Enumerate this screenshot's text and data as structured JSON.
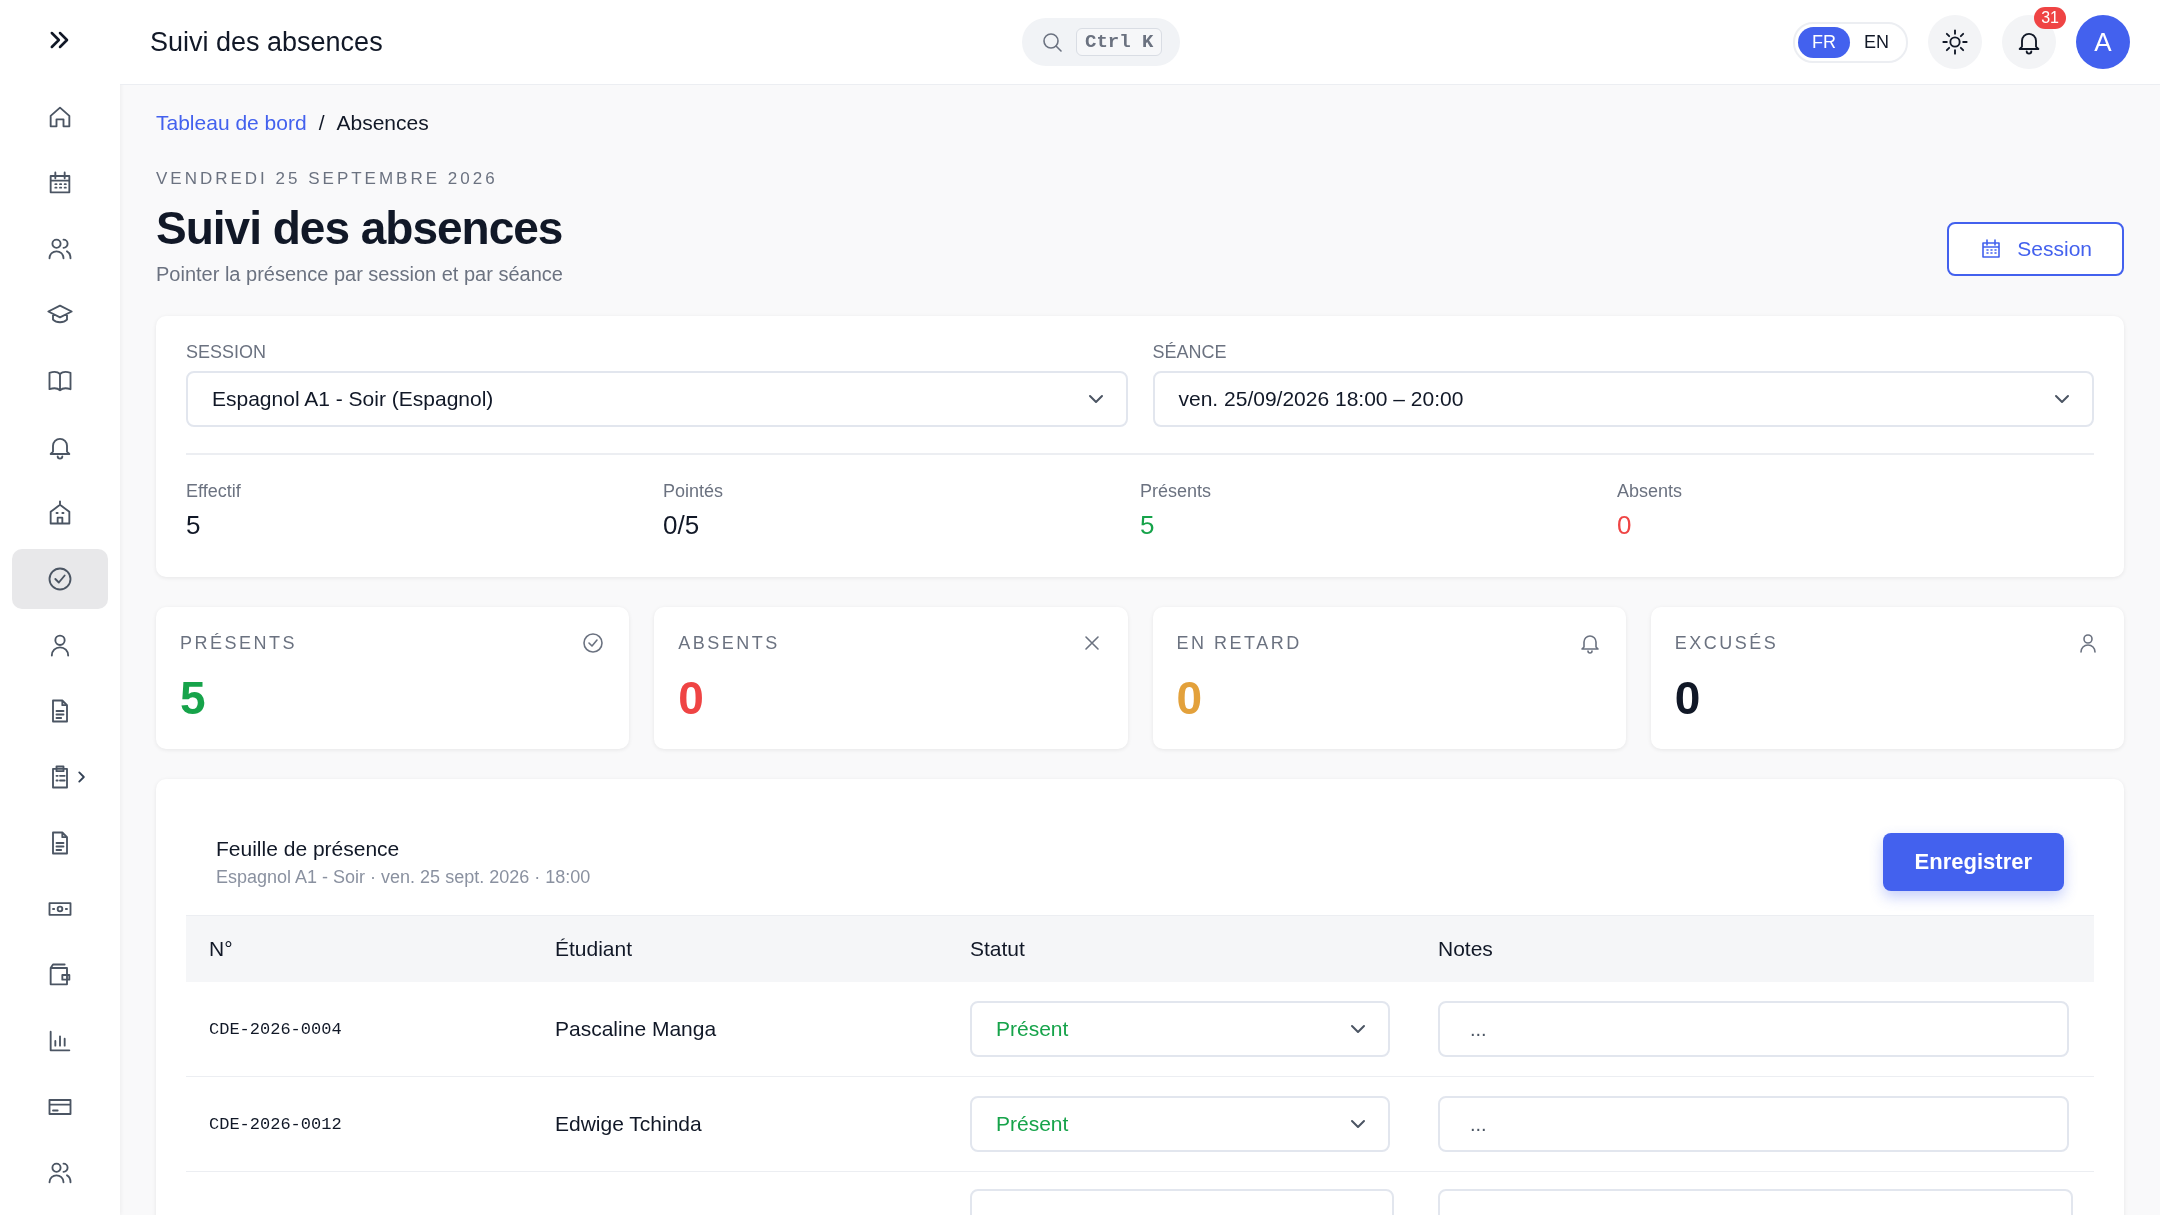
{
  "header": {
    "title": "Suivi des absences",
    "search_shortcut": "Ctrl K",
    "languages": [
      {
        "label": "FR",
        "selected": true
      },
      {
        "label": "EN",
        "selected": false
      }
    ],
    "notifications_badge": "31",
    "avatar": "A"
  },
  "sidebar": {
    "items": [
      {
        "kind": "link",
        "selected": false
      },
      {
        "kind": "link",
        "selected": false
      },
      {
        "kind": "link",
        "selected": false
      },
      {
        "kind": "link",
        "selected": false
      },
      {
        "kind": "link",
        "selected": false
      },
      {
        "kind": "link",
        "selected": false
      },
      {
        "kind": "link",
        "selected": false
      },
      {
        "kind": "link",
        "selected": true
      },
      {
        "kind": "link",
        "selected": false
      },
      {
        "kind": "link",
        "selected": false
      },
      {
        "kind": "group",
        "selected": false
      },
      {
        "kind": "link",
        "selected": false
      },
      {
        "kind": "link",
        "selected": false
      },
      {
        "kind": "link",
        "selected": false
      },
      {
        "kind": "link",
        "selected": false
      },
      {
        "kind": "link",
        "selected": false
      },
      {
        "kind": "link",
        "selected": false
      }
    ]
  },
  "breadcrumb": [
    {
      "label": "Tableau de bord",
      "kind": "link"
    },
    {
      "label": "Absences",
      "kind": "current",
      "separator": "/"
    }
  ],
  "page": {
    "date": "VENDREDI 25 SEPTEMBRE 2026",
    "title": "Suivi des absences",
    "subtitle": "Pointer la présence par session et par séance",
    "action_button": "Session"
  },
  "filters": [
    {
      "label": "SESSION",
      "value": "Espagnol A1 - Soir (Espagnol)"
    },
    {
      "label": "SÉANCE",
      "value": "ven. 25/09/2026 18:00 – 20:00"
    }
  ],
  "summary": [
    {
      "label": "Effectif",
      "value": "5",
      "color": "#111827"
    },
    {
      "label": "Pointés",
      "value": "0/5",
      "color": "#111827"
    },
    {
      "label": "Présents",
      "value": "5",
      "color": "#16a34a"
    },
    {
      "label": "Absents",
      "value": "0",
      "color": "#ef4444"
    }
  ],
  "stat_cards": [
    {
      "label": "PRÉSENTS",
      "value": "5",
      "color": "#16a34a"
    },
    {
      "label": "ABSENTS",
      "value": "0",
      "color": "#ef4444"
    },
    {
      "label": "EN RETARD",
      "value": "0",
      "color": "#e3a13b"
    },
    {
      "label": "EXCUSÉS",
      "value": "0",
      "color": "#111827"
    }
  ],
  "sheet": {
    "title": "Feuille de présence",
    "subtitle": "Espagnol A1 - Soir · ven. 25 sept. 2026 · 18:00",
    "save_button": "Enregistrer",
    "columns": [
      "N°",
      "Étudiant",
      "Statut",
      "Notes"
    ],
    "rows": [
      {
        "number": "CDE-2026-0004",
        "student": "Pascaline Manga",
        "status": "Présent",
        "notes_placeholder": "..."
      },
      {
        "number": "CDE-2026-0012",
        "student": "Edwige Tchinda",
        "status": "Présent",
        "notes_placeholder": "..."
      }
    ]
  }
}
